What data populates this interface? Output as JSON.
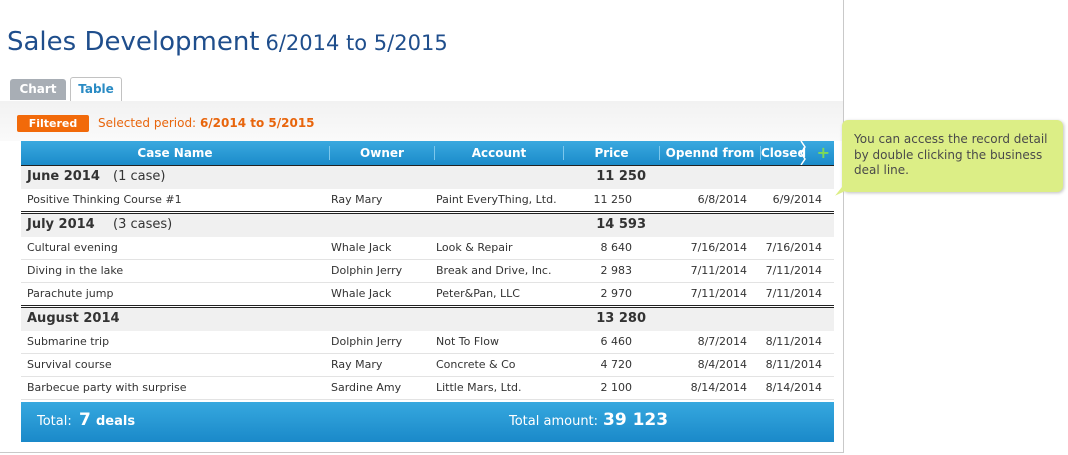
{
  "title": {
    "main": "Sales Development",
    "period": "6/2014 to 5/2015"
  },
  "tabs": [
    {
      "label": "Chart"
    },
    {
      "label": "Table"
    }
  ],
  "filter": {
    "badge": "Filtered",
    "selected_label": "Selected period:",
    "selected_value": "6/2014 to 5/2015"
  },
  "columns": {
    "case_name": "Case Name",
    "owner": "Owner",
    "account": "Account",
    "price": "Price",
    "opened": "Opennd from",
    "closed": "Closed"
  },
  "groups": [
    {
      "name": "June 2014",
      "count": "(1 case)",
      "total": "11 250",
      "rows": [
        {
          "case": "Positive Thinking Course #1",
          "owner": "Ray Mary",
          "account": "Paint EveryThing, Ltd.",
          "price": "11 250",
          "opened": "6/8/2014",
          "closed": "6/9/2014"
        }
      ]
    },
    {
      "name": "July 2014",
      "count": "(3 cases)",
      "total": "14 593",
      "rows": [
        {
          "case": "Cultural evening",
          "owner": "Whale Jack",
          "account": "Look & Repair",
          "price": "8 640",
          "opened": "7/16/2014",
          "closed": "7/16/2014"
        },
        {
          "case": "Diving in the lake",
          "owner": "Dolphin Jerry",
          "account": "Break and Drive, Inc.",
          "price": "2 983",
          "opened": "7/11/2014",
          "closed": "7/11/2014"
        },
        {
          "case": "Parachute jump",
          "owner": "Whale Jack",
          "account": "Peter&Pan, LLC",
          "price": "2 970",
          "opened": "7/11/2014",
          "closed": "7/11/2014"
        }
      ]
    },
    {
      "name": "August 2014",
      "count": "",
      "total": "13 280",
      "rows": [
        {
          "case": "Submarine trip",
          "owner": "Dolphin Jerry",
          "account": "Not To Flow",
          "price": "6 460",
          "opened": "8/7/2014",
          "closed": "8/11/2014"
        },
        {
          "case": "Survival course",
          "owner": "Ray Mary",
          "account": "Concrete & Co",
          "price": "4 720",
          "opened": "8/4/2014",
          "closed": "8/11/2014"
        },
        {
          "case": "Barbecue party with surprise",
          "owner": "Sardine Amy",
          "account": "Little Mars, Ltd.",
          "price": "2 100",
          "opened": "8/14/2014",
          "closed": "8/14/2014"
        }
      ]
    }
  ],
  "footer": {
    "total_label": "Total:",
    "total_value": "7",
    "deals_label": "deals",
    "amount_label": "Total amount:",
    "amount_value": "39 123"
  },
  "tooltip": {
    "text": "You can access the record detail by double clicking the business deal line."
  },
  "icons": {
    "add": "plus-icon"
  },
  "colors": {
    "header": "#1b8bca",
    "accent": "#f26a0a",
    "title": "#1f4e8c",
    "tooltip": "#dcee86",
    "add": "#7ed957"
  }
}
